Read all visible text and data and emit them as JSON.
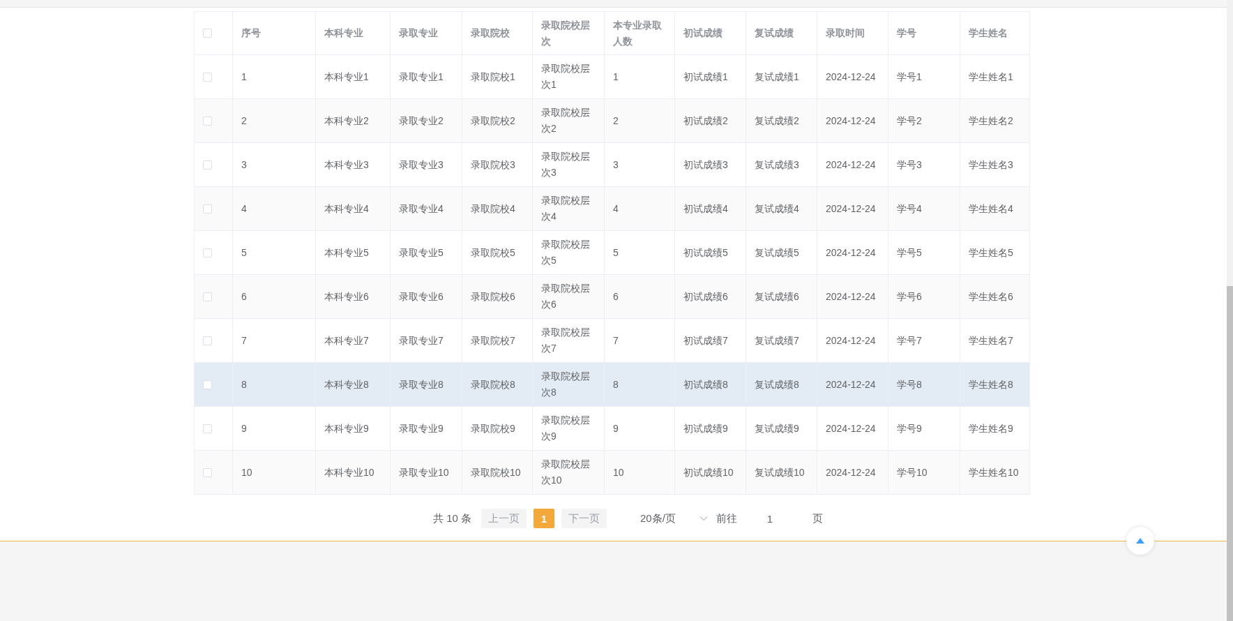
{
  "table": {
    "select_all": {
      "checked": false
    },
    "columns": [
      "序号",
      "本科专业",
      "录取专业",
      "录取院校",
      "录取院校层次",
      "本专业录取人数",
      "初试成绩",
      "复试成绩",
      "录取时间",
      "学号",
      "学生姓名"
    ],
    "rows": [
      {
        "checked": false,
        "hovered": false,
        "cells": [
          "1",
          "本科专业1",
          "录取专业1",
          "录取院校1",
          "录取院校层次1",
          "1",
          "初试成绩1",
          "复试成绩1",
          "2024-12-24",
          "学号1",
          "学生姓名1"
        ]
      },
      {
        "checked": false,
        "hovered": false,
        "cells": [
          "2",
          "本科专业2",
          "录取专业2",
          "录取院校2",
          "录取院校层次2",
          "2",
          "初试成绩2",
          "复试成绩2",
          "2024-12-24",
          "学号2",
          "学生姓名2"
        ]
      },
      {
        "checked": false,
        "hovered": false,
        "cells": [
          "3",
          "本科专业3",
          "录取专业3",
          "录取院校3",
          "录取院校层次3",
          "3",
          "初试成绩3",
          "复试成绩3",
          "2024-12-24",
          "学号3",
          "学生姓名3"
        ]
      },
      {
        "checked": false,
        "hovered": false,
        "cells": [
          "4",
          "本科专业4",
          "录取专业4",
          "录取院校4",
          "录取院校层次4",
          "4",
          "初试成绩4",
          "复试成绩4",
          "2024-12-24",
          "学号4",
          "学生姓名4"
        ]
      },
      {
        "checked": false,
        "hovered": false,
        "cells": [
          "5",
          "本科专业5",
          "录取专业5",
          "录取院校5",
          "录取院校层次5",
          "5",
          "初试成绩5",
          "复试成绩5",
          "2024-12-24",
          "学号5",
          "学生姓名5"
        ]
      },
      {
        "checked": false,
        "hovered": false,
        "cells": [
          "6",
          "本科专业6",
          "录取专业6",
          "录取院校6",
          "录取院校层次6",
          "6",
          "初试成绩6",
          "复试成绩6",
          "2024-12-24",
          "学号6",
          "学生姓名6"
        ]
      },
      {
        "checked": false,
        "hovered": false,
        "cells": [
          "7",
          "本科专业7",
          "录取专业7",
          "录取院校7",
          "录取院校层次7",
          "7",
          "初试成绩7",
          "复试成绩7",
          "2024-12-24",
          "学号7",
          "学生姓名7"
        ]
      },
      {
        "checked": false,
        "hovered": true,
        "cells": [
          "8",
          "本科专业8",
          "录取专业8",
          "录取院校8",
          "录取院校层次8",
          "8",
          "初试成绩8",
          "复试成绩8",
          "2024-12-24",
          "学号8",
          "学生姓名8"
        ]
      },
      {
        "checked": false,
        "hovered": false,
        "cells": [
          "9",
          "本科专业9",
          "录取专业9",
          "录取院校9",
          "录取院校层次9",
          "9",
          "初试成绩9",
          "复试成绩9",
          "2024-12-24",
          "学号9",
          "学生姓名9"
        ]
      },
      {
        "checked": false,
        "hovered": false,
        "cells": [
          "10",
          "本科专业10",
          "录取专业10",
          "录取院校10",
          "录取院校层次10",
          "10",
          "初试成绩10",
          "复试成绩10",
          "2024-12-24",
          "学号10",
          "学生姓名10"
        ]
      }
    ]
  },
  "pagination": {
    "total": "共 10 条",
    "prev": {
      "label": "上一页",
      "disabled": true
    },
    "pages": [
      {
        "label": "1",
        "selected": true
      }
    ],
    "next": {
      "label": "下一页",
      "disabled": true
    },
    "page_size": "20条/页",
    "goto_label": "前往",
    "goto_value": "1",
    "goto_suffix": "页"
  }
}
